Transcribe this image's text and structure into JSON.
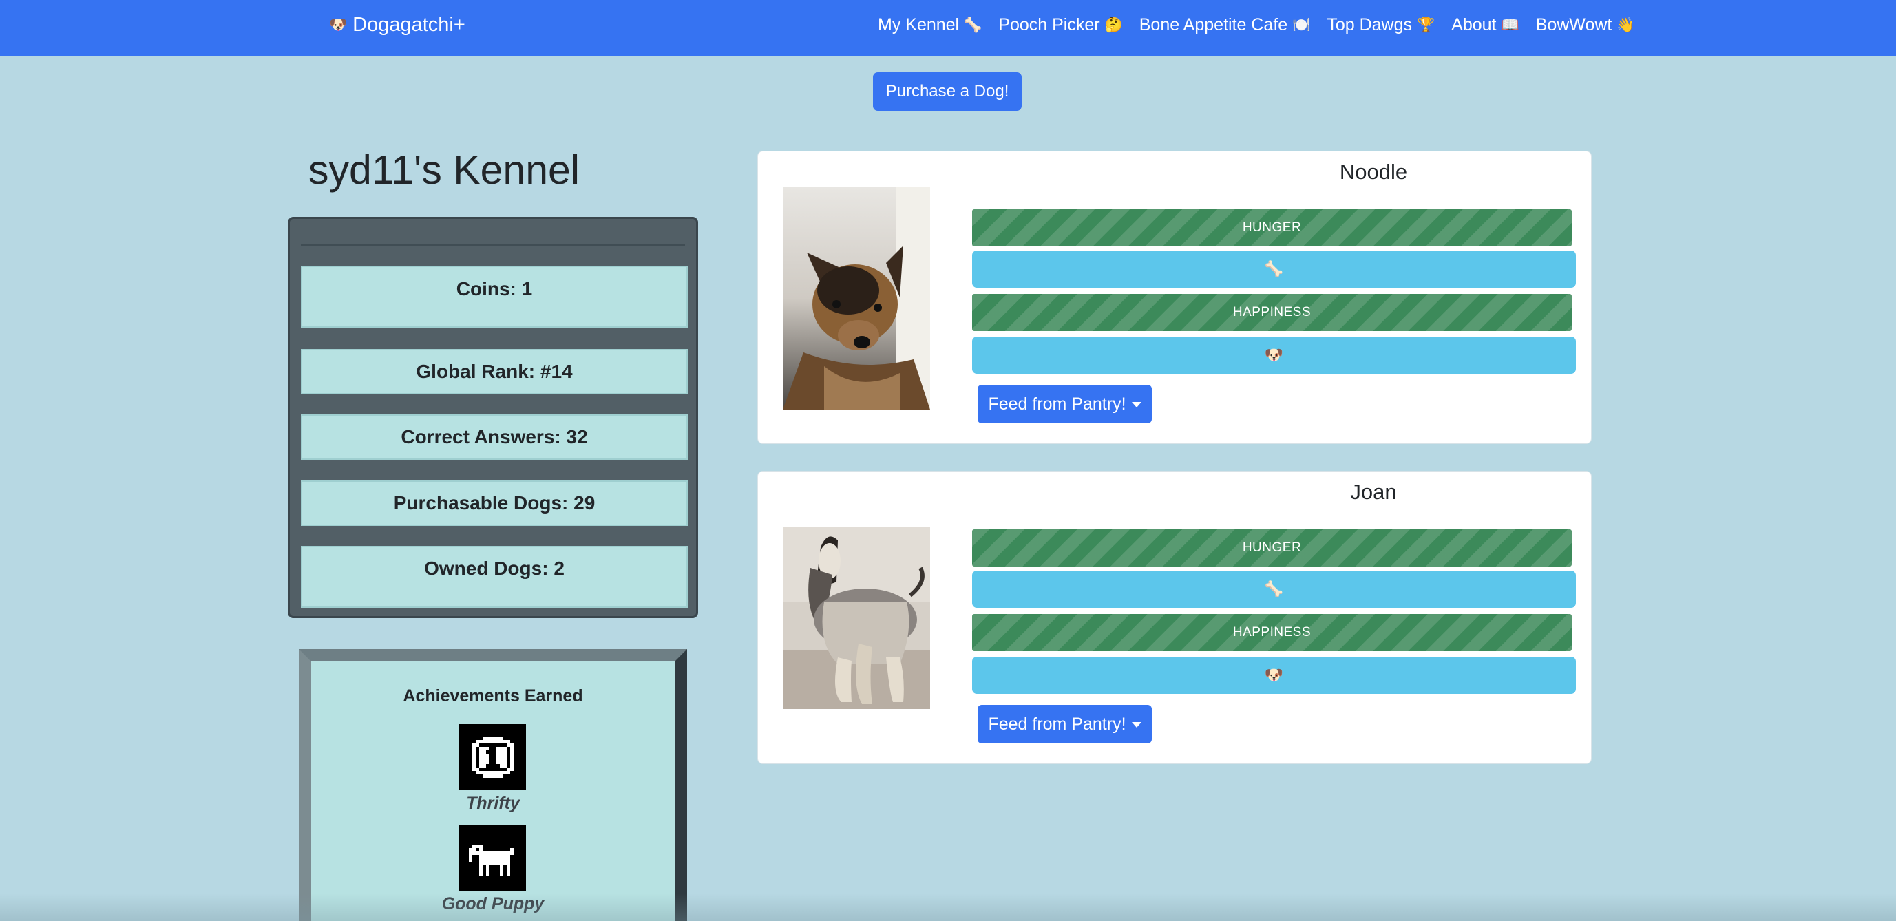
{
  "navbar": {
    "brand_emoji": "🐶",
    "brand": "Dogagatchi+",
    "links": [
      {
        "label": "My Kennel",
        "emoji": "🦴"
      },
      {
        "label": "Pooch Picker",
        "emoji": "🤔"
      },
      {
        "label": "Bone Appetite Cafe",
        "emoji": "🍽️"
      },
      {
        "label": "Top Dawgs",
        "emoji": "🏆"
      },
      {
        "label": "About",
        "emoji": "📖"
      },
      {
        "label": "BowWowt",
        "emoji": "👋"
      }
    ]
  },
  "purchase_label": "Purchase a Dog!",
  "kennel_title": "syd11's Kennel",
  "stats": {
    "coins": "Coins: 1",
    "rank": "Global Rank: #14",
    "correct": "Correct Answers: 32",
    "purchasable": "Purchasable Dogs: 29",
    "owned": "Owned Dogs: 2"
  },
  "achievements": {
    "title": "Achievements Earned",
    "items": [
      {
        "label": "Thrifty",
        "icon": "coin-icon"
      },
      {
        "label": "Good Puppy",
        "icon": "pixel-dog-icon"
      }
    ]
  },
  "dogs": [
    {
      "name": "Noodle",
      "hunger_label": "HUNGER",
      "hunger_level": 0.99,
      "hunger_emoji": "🦴",
      "happiness_label": "HAPPINESS",
      "happiness_level": 0.99,
      "happiness_emoji": "🐶",
      "feed_label": "Feed from Pantry!"
    },
    {
      "name": "Joan",
      "hunger_label": "HUNGER",
      "hunger_level": 0.99,
      "hunger_emoji": "🦴",
      "happiness_label": "HAPPINESS",
      "happiness_level": 0.99,
      "happiness_emoji": "🐶",
      "feed_label": "Feed from Pantry!"
    }
  ],
  "colors": {
    "navbar": "#3673f2",
    "page_background": "#b7d8e3",
    "bar_green": "#3c8a5a",
    "bar_blue": "#5cc6eb",
    "stat_box": "#b7e2e2"
  }
}
